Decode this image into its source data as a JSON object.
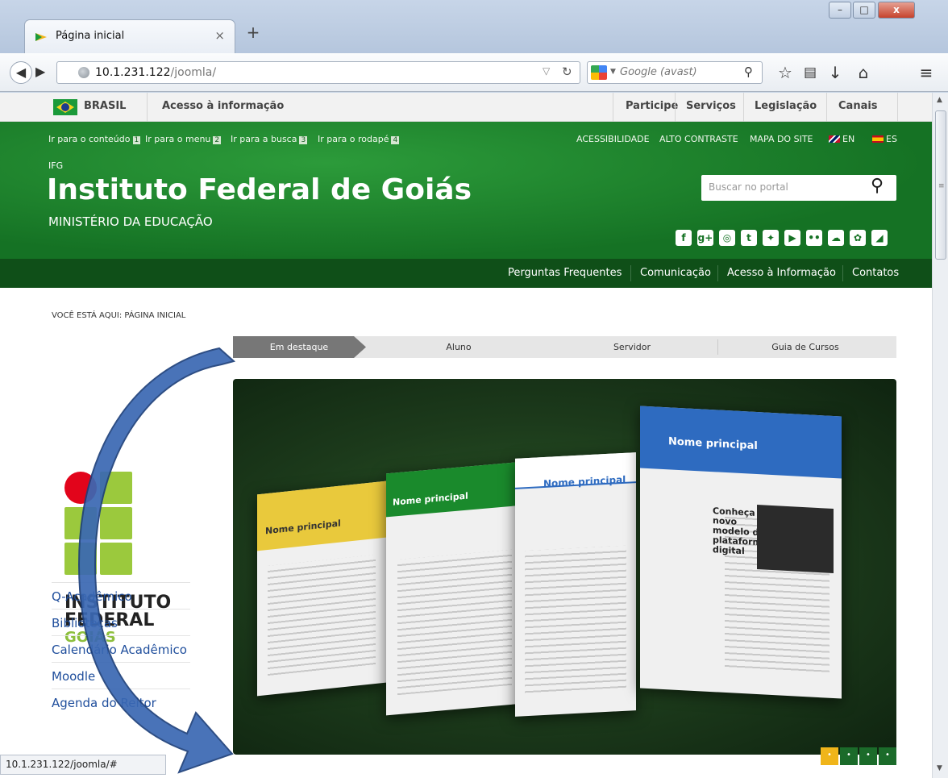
{
  "browser": {
    "tab_title": "Página inicial",
    "tab_close": "×",
    "new_tab": "+",
    "url_host": "10.1.231.122",
    "url_path": "/joomla/",
    "search_placeholder": "Google (avast)",
    "window_controls": {
      "minimize": "–",
      "maximize": "□",
      "close": "x"
    },
    "toolbar_icons": [
      "bookmark-star-icon",
      "reading-list-icon",
      "download-icon",
      "home-icon",
      "menu-icon"
    ],
    "status_text": "10.1.231.122/joomla/#"
  },
  "govbar": {
    "country": "BRASIL",
    "access_info": "Acesso à informação",
    "links": [
      "Participe",
      "Serviços",
      "Legislação",
      "Canais"
    ]
  },
  "header": {
    "skip_links": [
      {
        "label": "Ir para o conteúdo",
        "key": "1"
      },
      {
        "label": "Ir para o menu",
        "key": "2"
      },
      {
        "label": "Ir para a busca",
        "key": "3"
      },
      {
        "label": "Ir para o rodapé",
        "key": "4"
      }
    ],
    "top_links": [
      "ACESSIBILIDADE",
      "ALTO CONTRASTE",
      "MAPA DO SITE"
    ],
    "lang_en": "EN",
    "lang_es": "ES",
    "acronym": "IFG",
    "title": "Instituto Federal de Goiás",
    "subtitle": "MINISTÉRIO DA EDUCAÇÃO",
    "search_placeholder": "Buscar no portal",
    "social_icons": [
      "facebook-icon",
      "google-plus-icon",
      "instagram-icon",
      "tumblr-icon",
      "twitter-icon",
      "youtube-icon",
      "flickr-icon",
      "soundcloud-icon",
      "slideshare-icon",
      "rss-icon"
    ],
    "nav": [
      "Perguntas Frequentes",
      "Comunicação",
      "Acesso à Informação",
      "Contatos"
    ]
  },
  "breadcrumb": "VOCÊ ESTÁ AQUI: PÁGINA INICIAL",
  "content_tabs": [
    "Em destaque",
    "Aluno",
    "Servidor",
    "Guia de Cursos"
  ],
  "logo": {
    "line1": "INSTITUTO",
    "line2": "FEDERAL",
    "line3": "GOIÁS"
  },
  "sidebar_links": [
    "Q-Acadêmico",
    "Bibliotecas",
    "Calendário Acadêmico",
    "Moodle",
    "Agenda do Reitor"
  ],
  "slideshow": {
    "mock_title": "Nome principal",
    "mock_headline": "Conheça o novo modelo de plataforma digital",
    "active_dot": 1,
    "dot_count": 4
  },
  "colors": {
    "header_green": "#157224",
    "dark_nav": "#0f4f18",
    "accent_yellow": "#f0b51a",
    "link_blue": "#1f4e9c",
    "arrow_blue": "#3a68b3"
  }
}
